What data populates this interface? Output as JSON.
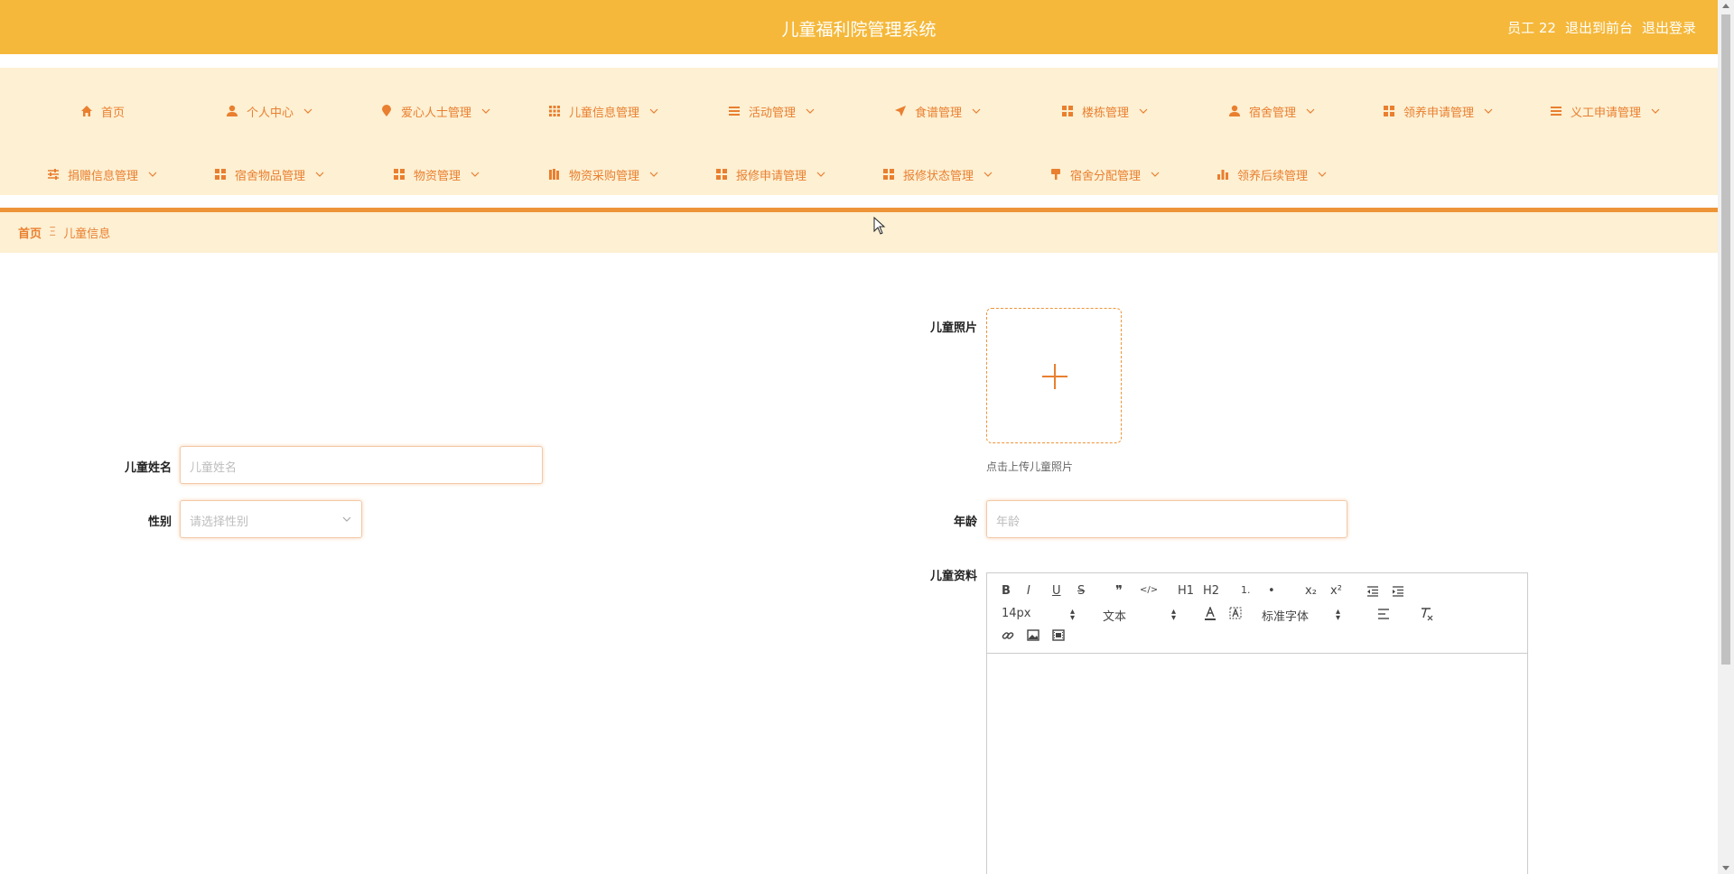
{
  "header": {
    "title": "儿童福利院管理系统",
    "user": "员工 22",
    "front_link": "退出到前台",
    "logout_link": "退出登录"
  },
  "menu": {
    "row1": [
      {
        "label": "首页",
        "icon": "home-icon"
      },
      {
        "label": "个人中心",
        "icon": "user-icon"
      },
      {
        "label": "爱心人士管理",
        "icon": "pin-icon"
      },
      {
        "label": "儿童信息管理",
        "icon": "grid9-icon"
      },
      {
        "label": "活动管理",
        "icon": "list-icon"
      },
      {
        "label": "食谱管理",
        "icon": "send-icon"
      },
      {
        "label": "楼栋管理",
        "icon": "grid4-icon"
      },
      {
        "label": "宿舍管理",
        "icon": "user-icon"
      },
      {
        "label": "领养申请管理",
        "icon": "grid4-icon"
      },
      {
        "label": "义工申请管理",
        "icon": "list-icon"
      }
    ],
    "row2": [
      {
        "label": "捐赠信息管理",
        "icon": "sliders-icon"
      },
      {
        "label": "宿舍物品管理",
        "icon": "grid4-icon"
      },
      {
        "label": "物资管理",
        "icon": "grid4-icon"
      },
      {
        "label": "物资采购管理",
        "icon": "books-icon"
      },
      {
        "label": "报修申请管理",
        "icon": "grid4-icon"
      },
      {
        "label": "报修状态管理",
        "icon": "grid4-icon"
      },
      {
        "label": "宿舍分配管理",
        "icon": "brush-icon"
      },
      {
        "label": "领养后续管理",
        "icon": "bar-chart-icon"
      }
    ]
  },
  "breadcrumb": {
    "home": "首页",
    "separator": "Ξ",
    "current": "儿童信息"
  },
  "form": {
    "photo_label": "儿童照片",
    "photo_tip": "点击上传儿童照片",
    "name_label": "儿童姓名",
    "name_placeholder": "儿童姓名",
    "gender_label": "性别",
    "gender_placeholder": "请选择性别",
    "age_label": "年龄",
    "age_placeholder": "年龄",
    "profile_label": "儿童资料"
  },
  "editor": {
    "font_size": "14px",
    "header_select": "文本",
    "font_family": "标准字体",
    "buttons": [
      "B",
      "I",
      "U",
      "S",
      "❞",
      "</>",
      "H1",
      "H2",
      "1.",
      "•",
      "x₂",
      "x²"
    ]
  },
  "colors": {
    "header_bg": "#f5b83a",
    "menu_bg": "#fdf0d3",
    "accent": "#e97f2f"
  }
}
